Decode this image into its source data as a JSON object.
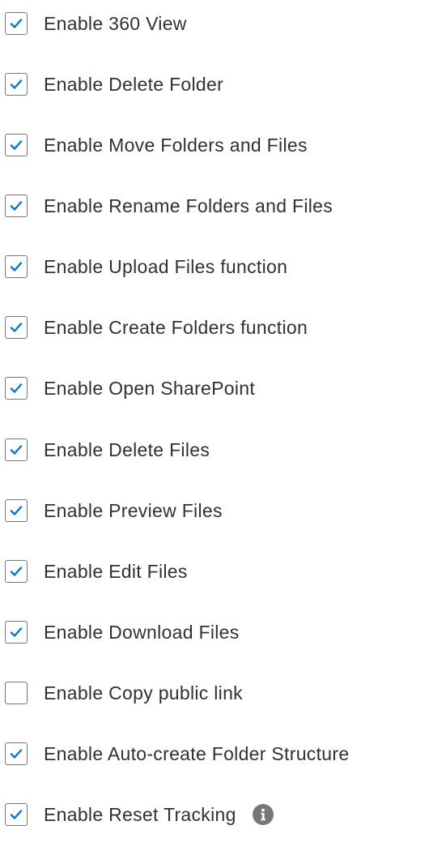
{
  "settings": {
    "items": [
      {
        "label": "Enable 360 View",
        "checked": true
      },
      {
        "label": "Enable Delete Folder",
        "checked": true
      },
      {
        "label": "Enable Move Folders and Files",
        "checked": true
      },
      {
        "label": "Enable Rename Folders and Files",
        "checked": true
      },
      {
        "label": "Enable Upload Files function",
        "checked": true
      },
      {
        "label": "Enable Create Folders function",
        "checked": true
      },
      {
        "label": "Enable Open SharePoint",
        "checked": true
      },
      {
        "label": "Enable Delete Files",
        "checked": true
      },
      {
        "label": "Enable Preview Files",
        "checked": true
      },
      {
        "label": "Enable Edit Files",
        "checked": true
      },
      {
        "label": "Enable Download Files",
        "checked": true
      },
      {
        "label": "Enable Copy public link",
        "checked": false
      },
      {
        "label": "Enable Auto-create Folder Structure",
        "checked": true
      },
      {
        "label": "Enable Reset Tracking",
        "checked": true,
        "info_icon": "info-icon"
      }
    ]
  },
  "colors": {
    "check": "#0078d4",
    "checkbox_border": "#757575",
    "label_text": "#323130",
    "info_icon_bg": "#777777"
  }
}
